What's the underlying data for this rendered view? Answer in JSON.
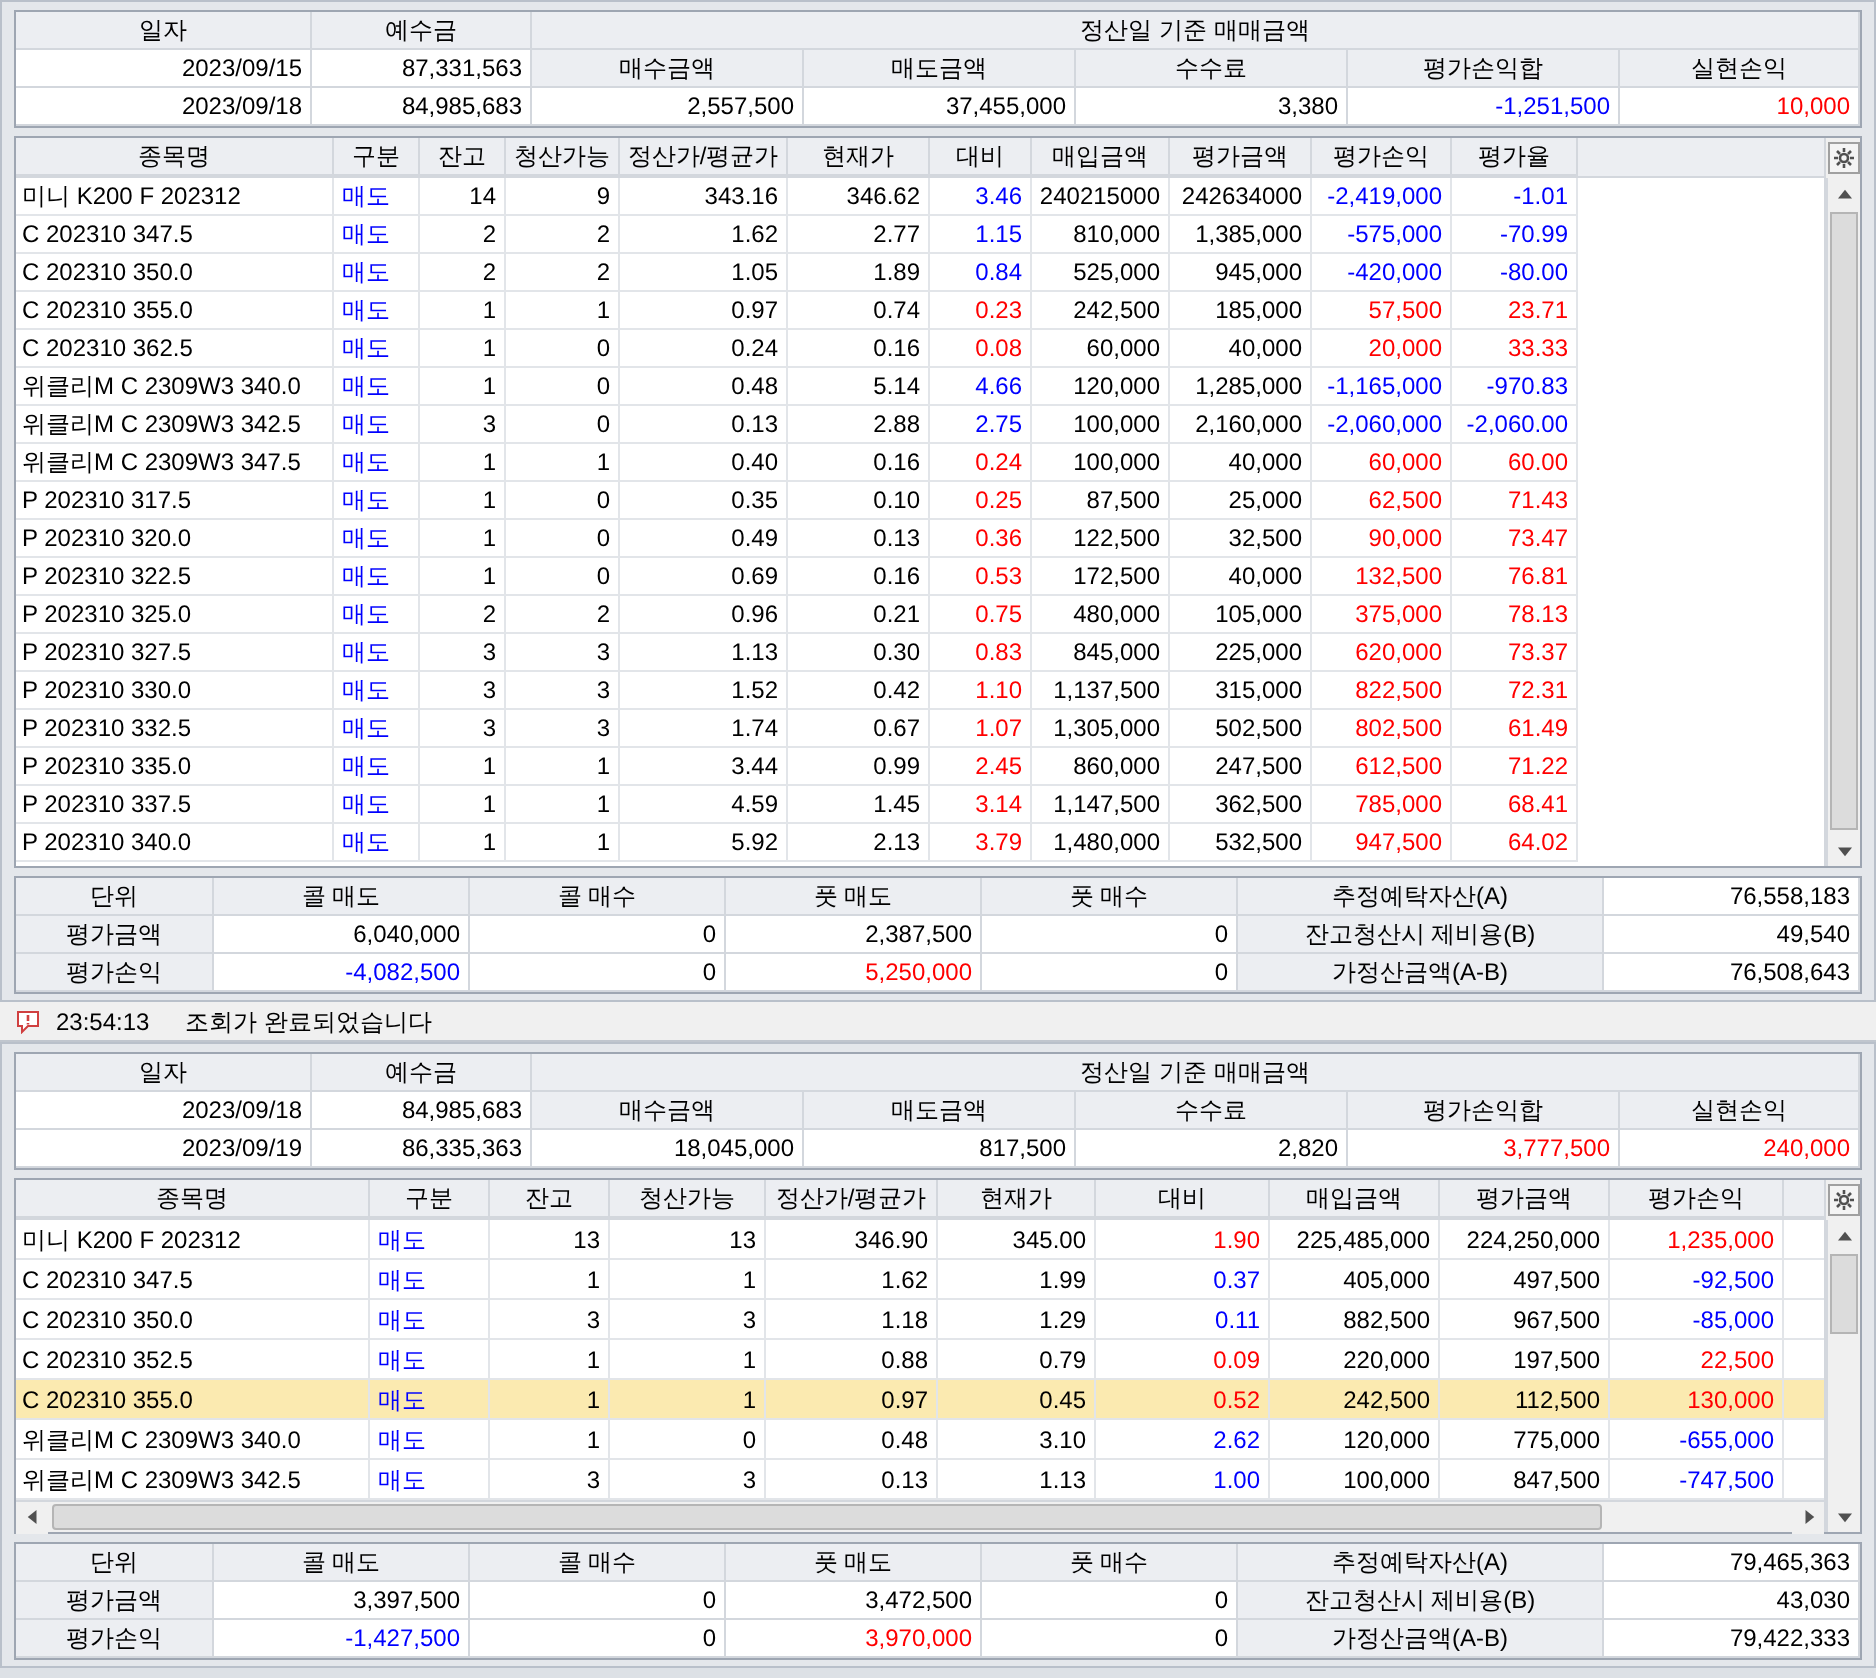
{
  "panels": [
    {
      "summary": {
        "headers": [
          "일자",
          "예수금",
          "정산일 기준 매매금액"
        ],
        "prev": {
          "date": "2023/09/15",
          "deposit": "87,331,563"
        },
        "sub_headers": [
          "매수금액",
          "매도금액",
          "수수료",
          "평가손익합",
          "실현손익"
        ],
        "current": {
          "date": "2023/09/18",
          "deposit": "84,985,683"
        },
        "values": [
          {
            "text": "2,557,500"
          },
          {
            "text": "37,455,000"
          },
          {
            "text": "3,380"
          },
          {
            "text": "-1,251,500",
            "color": "#0000ff"
          },
          {
            "text": "10,000",
            "color": "#ff0000"
          }
        ]
      },
      "positions": {
        "columns": [
          {
            "label": "종목명",
            "kind": "text"
          },
          {
            "label": "구분",
            "kind": "side"
          },
          {
            "label": "잔고",
            "kind": "num"
          },
          {
            "label": "청산가능",
            "kind": "num"
          },
          {
            "label": "정산가/평균가",
            "kind": "num"
          },
          {
            "label": "현재가",
            "kind": "num"
          },
          {
            "label": "대비",
            "kind": "toned"
          },
          {
            "label": "매입금액",
            "kind": "num"
          },
          {
            "label": "평가금액",
            "kind": "num"
          },
          {
            "label": "평가손익",
            "kind": "toned"
          },
          {
            "label": "평가율",
            "kind": "toned"
          }
        ],
        "rows": [
          {
            "selected": false,
            "color": "#0000ff",
            "cells": [
              "미니 K200 F 202312",
              "매도",
              "14",
              "9",
              "343.16",
              "346.62",
              "3.46",
              "240215000",
              "242634000",
              "-2,419,000",
              "-1.01"
            ]
          },
          {
            "selected": false,
            "color": "#0000ff",
            "cells": [
              "C 202310 347.5",
              "매도",
              "2",
              "2",
              "1.62",
              "2.77",
              "1.15",
              "810,000",
              "1,385,000",
              "-575,000",
              "-70.99"
            ]
          },
          {
            "selected": false,
            "color": "#0000ff",
            "cells": [
              "C 202310 350.0",
              "매도",
              "2",
              "2",
              "1.05",
              "1.89",
              "0.84",
              "525,000",
              "945,000",
              "-420,000",
              "-80.00"
            ]
          },
          {
            "selected": false,
            "color": "#ff0000",
            "cells": [
              "C 202310 355.0",
              "매도",
              "1",
              "1",
              "0.97",
              "0.74",
              "0.23",
              "242,500",
              "185,000",
              "57,500",
              "23.71"
            ]
          },
          {
            "selected": false,
            "color": "#ff0000",
            "cells": [
              "C 202310 362.5",
              "매도",
              "1",
              "0",
              "0.24",
              "0.16",
              "0.08",
              "60,000",
              "40,000",
              "20,000",
              "33.33"
            ]
          },
          {
            "selected": false,
            "color": "#0000ff",
            "cells": [
              "위클리M C 2309W3 340.0",
              "매도",
              "1",
              "0",
              "0.48",
              "5.14",
              "4.66",
              "120,000",
              "1,285,000",
              "-1,165,000",
              "-970.83"
            ]
          },
          {
            "selected": false,
            "color": "#0000ff",
            "cells": [
              "위클리M C 2309W3 342.5",
              "매도",
              "3",
              "0",
              "0.13",
              "2.88",
              "2.75",
              "100,000",
              "2,160,000",
              "-2,060,000",
              "-2,060.00"
            ]
          },
          {
            "selected": false,
            "color": "#ff0000",
            "cells": [
              "위클리M C 2309W3 347.5",
              "매도",
              "1",
              "1",
              "0.40",
              "0.16",
              "0.24",
              "100,000",
              "40,000",
              "60,000",
              "60.00"
            ]
          },
          {
            "selected": false,
            "color": "#ff0000",
            "cells": [
              "P 202310 317.5",
              "매도",
              "1",
              "0",
              "0.35",
              "0.10",
              "0.25",
              "87,500",
              "25,000",
              "62,500",
              "71.43"
            ]
          },
          {
            "selected": false,
            "color": "#ff0000",
            "cells": [
              "P 202310 320.0",
              "매도",
              "1",
              "0",
              "0.49",
              "0.13",
              "0.36",
              "122,500",
              "32,500",
              "90,000",
              "73.47"
            ]
          },
          {
            "selected": false,
            "color": "#ff0000",
            "cells": [
              "P 202310 322.5",
              "매도",
              "1",
              "0",
              "0.69",
              "0.16",
              "0.53",
              "172,500",
              "40,000",
              "132,500",
              "76.81"
            ]
          },
          {
            "selected": false,
            "color": "#ff0000",
            "cells": [
              "P 202310 325.0",
              "매도",
              "2",
              "2",
              "0.96",
              "0.21",
              "0.75",
              "480,000",
              "105,000",
              "375,000",
              "78.13"
            ]
          },
          {
            "selected": false,
            "color": "#ff0000",
            "cells": [
              "P 202310 327.5",
              "매도",
              "3",
              "3",
              "1.13",
              "0.30",
              "0.83",
              "845,000",
              "225,000",
              "620,000",
              "73.37"
            ]
          },
          {
            "selected": false,
            "color": "#ff0000",
            "cells": [
              "P 202310 330.0",
              "매도",
              "3",
              "3",
              "1.52",
              "0.42",
              "1.10",
              "1,137,500",
              "315,000",
              "822,500",
              "72.31"
            ]
          },
          {
            "selected": false,
            "color": "#ff0000",
            "cells": [
              "P 202310 332.5",
              "매도",
              "3",
              "3",
              "1.74",
              "0.67",
              "1.07",
              "1,305,000",
              "502,500",
              "802,500",
              "61.49"
            ]
          },
          {
            "selected": false,
            "color": "#ff0000",
            "cells": [
              "P 202310 335.0",
              "매도",
              "1",
              "1",
              "3.44",
              "0.99",
              "2.45",
              "860,000",
              "247,500",
              "612,500",
              "71.22"
            ]
          },
          {
            "selected": false,
            "color": "#ff0000",
            "cells": [
              "P 202310 337.5",
              "매도",
              "1",
              "1",
              "4.59",
              "1.45",
              "3.14",
              "1,147,500",
              "362,500",
              "785,000",
              "68.41"
            ]
          },
          {
            "selected": false,
            "color": "#ff0000",
            "cells": [
              "P 202310 340.0",
              "매도",
              "1",
              "1",
              "5.92",
              "2.13",
              "3.79",
              "1,480,000",
              "532,500",
              "947,500",
              "64.02"
            ]
          }
        ]
      },
      "totals": [
        [
          {
            "text": "단위",
            "kind": "label"
          },
          {
            "text": "콜 매도",
            "kind": "label"
          },
          {
            "text": "콜 매수",
            "kind": "label"
          },
          {
            "text": "풋 매도",
            "kind": "label"
          },
          {
            "text": "풋 매수",
            "kind": "label"
          },
          {
            "text": "추정예탁자산(A)",
            "kind": "label"
          },
          {
            "text": "76,558,183",
            "kind": "value"
          }
        ],
        [
          {
            "text": "평가금액",
            "kind": "label"
          },
          {
            "text": "6,040,000",
            "kind": "value"
          },
          {
            "text": "0",
            "kind": "value"
          },
          {
            "text": "2,387,500",
            "kind": "value"
          },
          {
            "text": "0",
            "kind": "value"
          },
          {
            "text": "잔고청산시 제비용(B)",
            "kind": "label"
          },
          {
            "text": "49,540",
            "kind": "value"
          }
        ],
        [
          {
            "text": "평가손익",
            "kind": "label"
          },
          {
            "text": "-4,082,500",
            "kind": "value",
            "color": "#0000ff"
          },
          {
            "text": "0",
            "kind": "value"
          },
          {
            "text": "5,250,000",
            "kind": "value",
            "color": "#ff0000"
          },
          {
            "text": "0",
            "kind": "value"
          },
          {
            "text": "가정산금액(A-B)",
            "kind": "label"
          },
          {
            "text": "76,508,643",
            "kind": "value"
          }
        ]
      ]
    },
    {
      "summary": {
        "headers": [
          "일자",
          "예수금",
          "정산일 기준 매매금액"
        ],
        "prev": {
          "date": "2023/09/18",
          "deposit": "84,985,683"
        },
        "sub_headers": [
          "매수금액",
          "매도금액",
          "수수료",
          "평가손익합",
          "실현손익"
        ],
        "current": {
          "date": "2023/09/19",
          "deposit": "86,335,363"
        },
        "values": [
          {
            "text": "18,045,000"
          },
          {
            "text": "817,500"
          },
          {
            "text": "2,820"
          },
          {
            "text": "3,777,500",
            "color": "#ff0000"
          },
          {
            "text": "240,000",
            "color": "#ff0000"
          }
        ]
      },
      "positions": {
        "columns": [
          {
            "label": "종목명",
            "kind": "text"
          },
          {
            "label": "구분",
            "kind": "side"
          },
          {
            "label": "잔고",
            "kind": "num"
          },
          {
            "label": "청산가능",
            "kind": "num"
          },
          {
            "label": "정산가/평균가",
            "kind": "num"
          },
          {
            "label": "현재가",
            "kind": "num"
          },
          {
            "label": "대비",
            "kind": "toned"
          },
          {
            "label": "매입금액",
            "kind": "num"
          },
          {
            "label": "평가금액",
            "kind": "num"
          },
          {
            "label": "평가손익",
            "kind": "toned"
          }
        ],
        "rows": [
          {
            "selected": false,
            "color": "#ff0000",
            "cells": [
              "미니 K200 F 202312",
              "매도",
              "13",
              "13",
              "346.90",
              "345.00",
              "1.90",
              "225,485,000",
              "224,250,000",
              "1,235,000"
            ]
          },
          {
            "selected": false,
            "color": "#0000ff",
            "cells": [
              "C 202310 347.5",
              "매도",
              "1",
              "1",
              "1.62",
              "1.99",
              "0.37",
              "405,000",
              "497,500",
              "-92,500"
            ]
          },
          {
            "selected": false,
            "color": "#0000ff",
            "cells": [
              "C 202310 350.0",
              "매도",
              "3",
              "3",
              "1.18",
              "1.29",
              "0.11",
              "882,500",
              "967,500",
              "-85,000"
            ]
          },
          {
            "selected": false,
            "color": "#ff0000",
            "cells": [
              "C 202310 352.5",
              "매도",
              "1",
              "1",
              "0.88",
              "0.79",
              "0.09",
              "220,000",
              "197,500",
              "22,500"
            ]
          },
          {
            "selected": true,
            "color": "#ff0000",
            "cells": [
              "C 202310 355.0",
              "매도",
              "1",
              "1",
              "0.97",
              "0.45",
              "0.52",
              "242,500",
              "112,500",
              "130,000"
            ]
          },
          {
            "selected": false,
            "color": "#0000ff",
            "cells": [
              "위클리M C 2309W3 340.0",
              "매도",
              "1",
              "0",
              "0.48",
              "3.10",
              "2.62",
              "120,000",
              "775,000",
              "-655,000"
            ]
          },
          {
            "selected": false,
            "color": "#0000ff",
            "cells": [
              "위클리M C 2309W3 342.5",
              "매도",
              "3",
              "3",
              "0.13",
              "1.13",
              "1.00",
              "100,000",
              "847,500",
              "-747,500"
            ]
          }
        ]
      },
      "totals": [
        [
          {
            "text": "단위",
            "kind": "label"
          },
          {
            "text": "콜 매도",
            "kind": "label"
          },
          {
            "text": "콜 매수",
            "kind": "label"
          },
          {
            "text": "풋 매도",
            "kind": "label"
          },
          {
            "text": "풋 매수",
            "kind": "label"
          },
          {
            "text": "추정예탁자산(A)",
            "kind": "label"
          },
          {
            "text": "79,465,363",
            "kind": "value"
          }
        ],
        [
          {
            "text": "평가금액",
            "kind": "label"
          },
          {
            "text": "3,397,500",
            "kind": "value"
          },
          {
            "text": "0",
            "kind": "value"
          },
          {
            "text": "3,472,500",
            "kind": "value"
          },
          {
            "text": "0",
            "kind": "value"
          },
          {
            "text": "잔고청산시 제비용(B)",
            "kind": "label"
          },
          {
            "text": "43,030",
            "kind": "value"
          }
        ],
        [
          {
            "text": "평가손익",
            "kind": "label"
          },
          {
            "text": "-1,427,500",
            "kind": "value",
            "color": "#0000ff"
          },
          {
            "text": "0",
            "kind": "value"
          },
          {
            "text": "3,970,000",
            "kind": "value",
            "color": "#ff0000"
          },
          {
            "text": "0",
            "kind": "value"
          },
          {
            "text": "가정산금액(A-B)",
            "kind": "label"
          },
          {
            "text": "79,422,333",
            "kind": "value"
          }
        ]
      ]
    }
  ],
  "status_bar": {
    "time": "23:54:13",
    "message": "조회가 완료되었습니다"
  }
}
